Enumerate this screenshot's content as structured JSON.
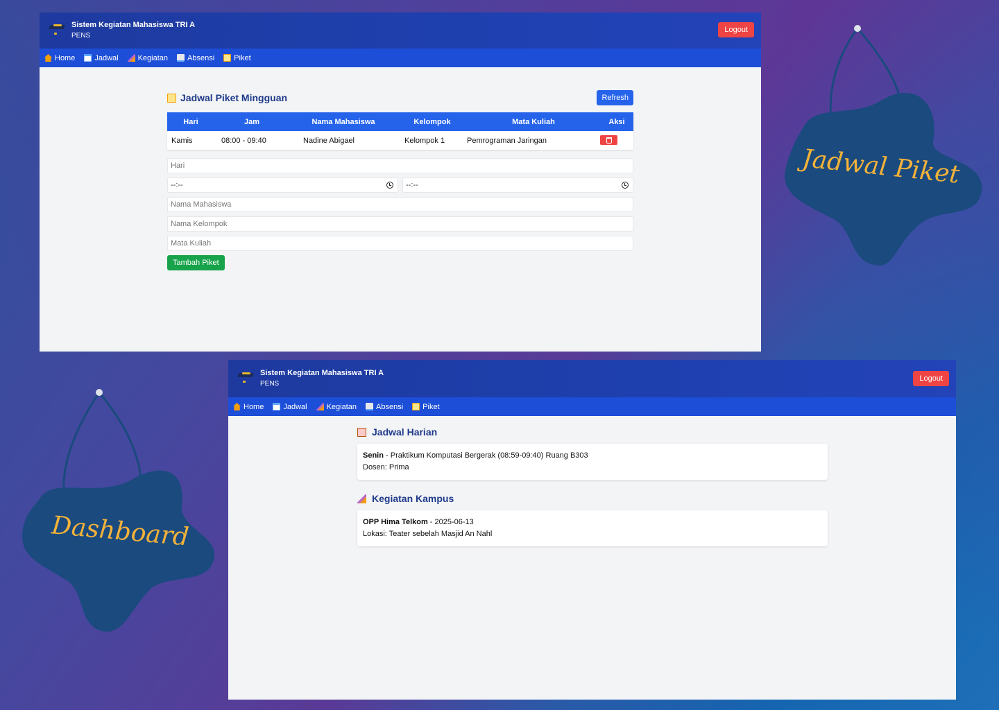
{
  "app": {
    "title": "Sistem Kegiatan Mahasiswa TRI A",
    "subtitle": "PENS",
    "logout_label": "Logout"
  },
  "nav": {
    "items": [
      {
        "label": "Home",
        "icon": "home-icon"
      },
      {
        "label": "Jadwal",
        "icon": "calendar-icon"
      },
      {
        "label": "Kegiatan",
        "icon": "party-icon"
      },
      {
        "label": "Absensi",
        "icon": "book-icon"
      },
      {
        "label": "Piket",
        "icon": "memo-icon"
      }
    ]
  },
  "piket": {
    "title": "Jadwal Piket Mingguan",
    "refresh_label": "Refresh",
    "columns": [
      "Hari",
      "Jam",
      "Nama Mahasiswa",
      "Kelompok",
      "Mata Kuliah",
      "Aksi"
    ],
    "rows": [
      {
        "hari": "Kamis",
        "jam": "08:00 - 09:40",
        "nama": "Nadine Abigael",
        "kelompok": "Kelompok 1",
        "matkul": "Pemrograman Jaringan"
      }
    ],
    "form": {
      "hari_placeholder": "Hari",
      "time_start": "--:--",
      "time_end": "--:--",
      "nama_placeholder": "Nama Mahasiswa",
      "kelompok_placeholder": "Nama Kelompok",
      "matkul_placeholder": "Mata Kuliah",
      "submit_label": "Tambah Piket"
    }
  },
  "dashboard": {
    "harian_title": "Jadwal Harian",
    "harian": {
      "day": "Senin",
      "detail": " - Praktikum Komputasi Bergerak (08:59-09:40) Ruang B303",
      "dosen": "Dosen: Prima"
    },
    "kampus_title": "Kegiatan Kampus",
    "kampus": {
      "name": "OPP Hima Telkom",
      "date": " - 2025-06-13",
      "lokasi": "Lokasi: Teater sebelah Masjid An Nahl"
    }
  },
  "signs": {
    "piket_label": "Jadwal Piket",
    "dashboard_label": "Dashboard"
  },
  "colors": {
    "topbar": "#1e40af",
    "navbar": "#1d4ed8",
    "table_header": "#2563eb",
    "logout": "#ef4444",
    "add_button": "#16a34a",
    "sign_blob": "#1a4a7e",
    "sign_text": "#f3b23a"
  }
}
